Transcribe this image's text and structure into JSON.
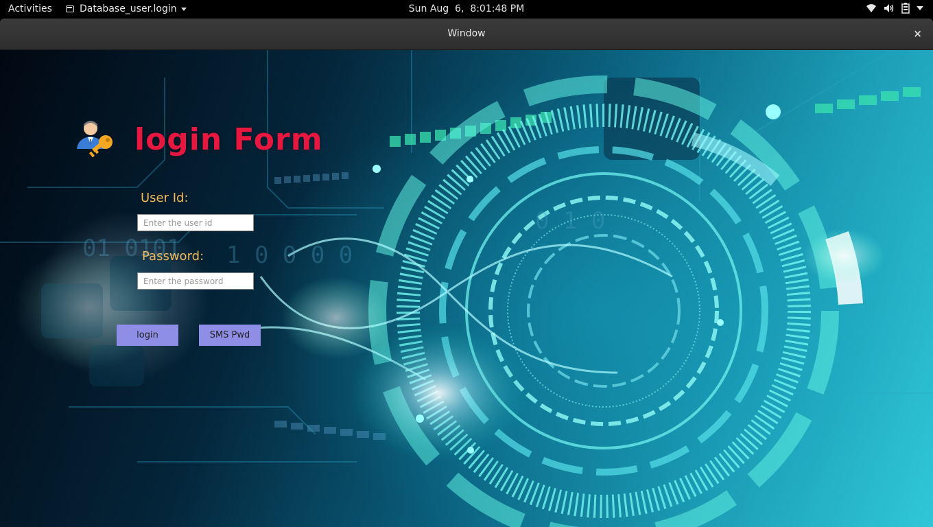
{
  "topbar": {
    "activities": "Activities",
    "app_name": "Database_user.login",
    "clock": "Sun Aug  6,  8:01:48 PM",
    "icons": [
      "wifi-icon",
      "volume-icon",
      "battery-icon",
      "power-menu-icon"
    ]
  },
  "window": {
    "title": "Window",
    "close_symbol": "×"
  },
  "form": {
    "title": "login Form",
    "header_icon": "user-key-icon",
    "user_id": {
      "label": "User Id:",
      "placeholder": "Enter the user id",
      "value": ""
    },
    "password": {
      "label": "Password:",
      "placeholder": "Enter the password",
      "value": ""
    },
    "login_button": "login",
    "sms_button": "SMS Pwd"
  },
  "colors": {
    "title_color": "#e8173f",
    "label_color": "#f0b95a",
    "button_color": "#8f8ee6"
  }
}
